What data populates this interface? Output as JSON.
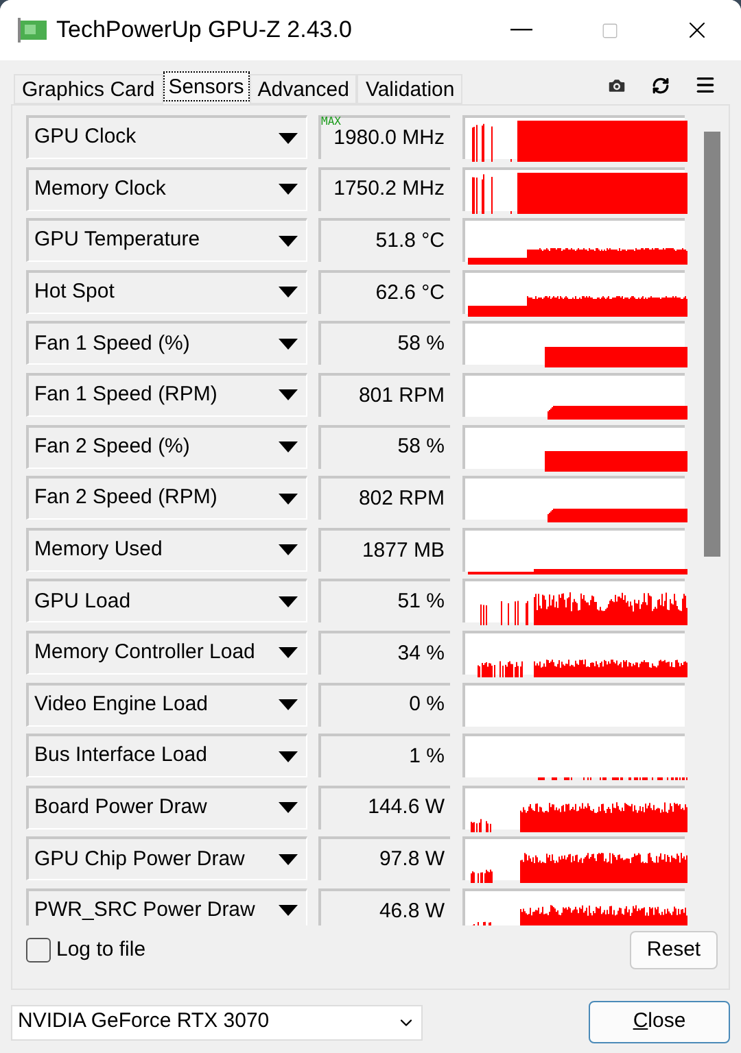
{
  "window": {
    "title": "TechPowerUp GPU-Z 2.43.0"
  },
  "tabs": [
    {
      "label": "Graphics Card",
      "selected": false
    },
    {
      "label": "Sensors",
      "selected": true
    },
    {
      "label": "Advanced",
      "selected": false
    },
    {
      "label": "Validation",
      "selected": false
    }
  ],
  "sensors": [
    {
      "name": "GPU Clock",
      "value": "1980.0 MHz",
      "badge": "MAX",
      "kind": "clock"
    },
    {
      "name": "Memory Clock",
      "value": "1750.2 MHz",
      "kind": "clock"
    },
    {
      "name": "GPU Temperature",
      "value": "51.8 °C",
      "kind": "temp"
    },
    {
      "name": "Hot Spot",
      "value": "62.6 °C",
      "kind": "hot"
    },
    {
      "name": "Fan 1 Speed (%)",
      "value": "58 %",
      "kind": "fan"
    },
    {
      "name": "Fan 1 Speed (RPM)",
      "value": "801 RPM",
      "kind": "rpm"
    },
    {
      "name": "Fan 2 Speed (%)",
      "value": "58 %",
      "kind": "fan"
    },
    {
      "name": "Fan 2 Speed (RPM)",
      "value": "802 RPM",
      "kind": "rpm"
    },
    {
      "name": "Memory Used",
      "value": "1877 MB",
      "kind": "mem"
    },
    {
      "name": "GPU Load",
      "value": "51 %",
      "kind": "load"
    },
    {
      "name": "Memory Controller Load",
      "value": "34 %",
      "kind": "mcload"
    },
    {
      "name": "Video Engine Load",
      "value": "0 %",
      "kind": "flat"
    },
    {
      "name": "Bus Interface Load",
      "value": "1 %",
      "kind": "bus"
    },
    {
      "name": "Board Power Draw",
      "value": "144.6 W",
      "kind": "power"
    },
    {
      "name": "GPU Chip Power Draw",
      "value": "97.8 W",
      "kind": "power"
    },
    {
      "name": "PWR_SRC Power Draw",
      "value": "46.8 W",
      "kind": "power"
    }
  ],
  "log_to_file": {
    "label": "Log to file",
    "checked": false
  },
  "reset_button": "Reset",
  "gpu_select": {
    "value": "NVIDIA GeForce RTX 3070"
  },
  "close_button": "Close"
}
